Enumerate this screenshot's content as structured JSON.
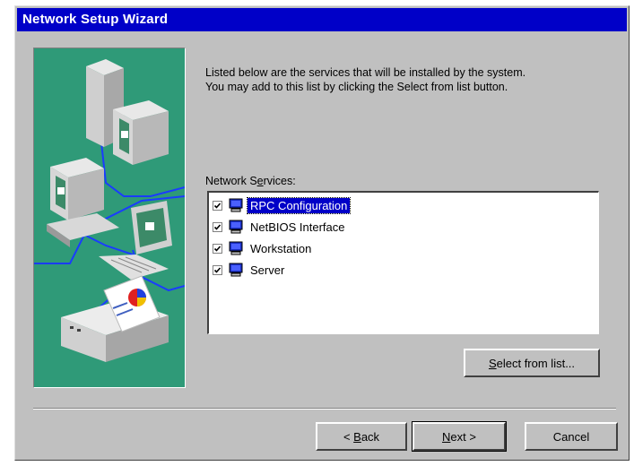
{
  "window": {
    "title": "Network Setup Wizard"
  },
  "description": {
    "line1": "Listed below are the services that will be installed by the system.",
    "line2": "You may add to this list by clicking the Select from list button."
  },
  "list": {
    "label_pre": "Network S",
    "label_u": "e",
    "label_post": "rvices:",
    "items": [
      {
        "label": "RPC Configuration",
        "checked": true,
        "selected": true
      },
      {
        "label": "NetBIOS Interface",
        "checked": true,
        "selected": false
      },
      {
        "label": "Workstation",
        "checked": true,
        "selected": false
      },
      {
        "label": "Server",
        "checked": true,
        "selected": false
      }
    ]
  },
  "buttons": {
    "select_u": "S",
    "select_rest": "elect from list...",
    "back_pre": "< ",
    "back_u": "B",
    "back_rest": "ack",
    "next_u": "N",
    "next_rest": "ext >",
    "cancel": "Cancel"
  },
  "colors": {
    "titlebar": "#0000c8",
    "art_bg": "#2f9a78",
    "dialog": "#c0c0c0"
  },
  "icons": [
    "checkbox-checked-icon",
    "network-service-icon",
    "network-computers-illustration"
  ]
}
